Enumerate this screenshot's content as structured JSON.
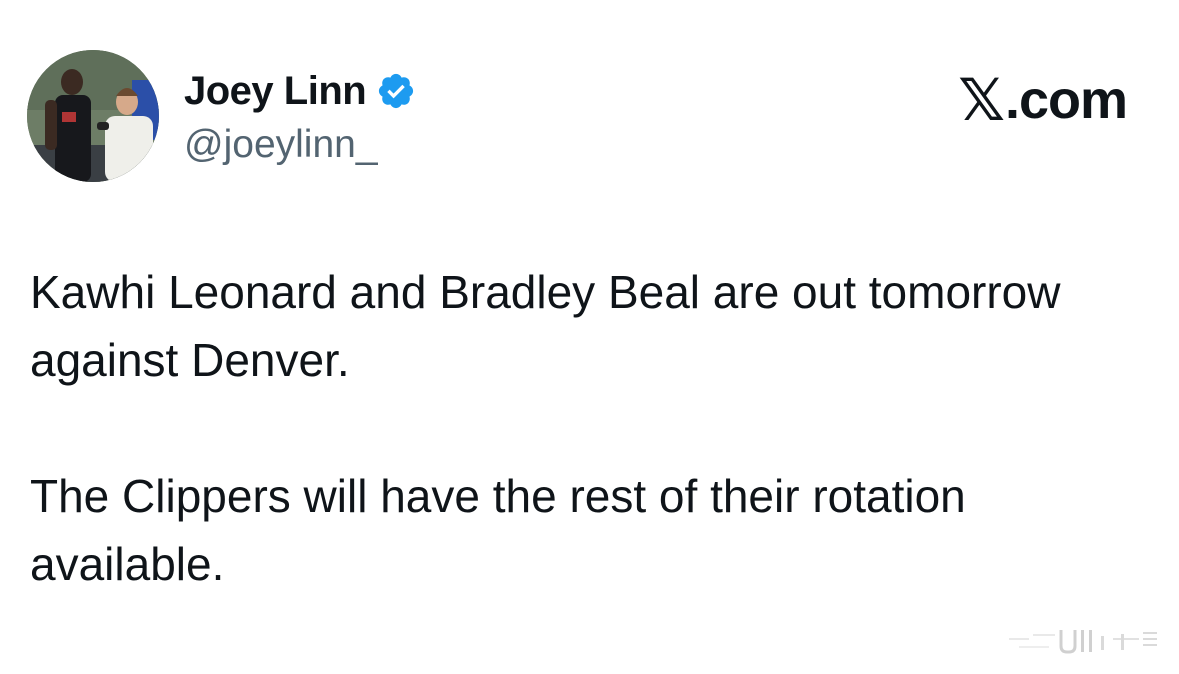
{
  "author": {
    "display_name": "Joey Linn",
    "handle": "@joeylinn_",
    "verified_icon": "verified-badge-icon",
    "avatar_icon": "profile-photo"
  },
  "brand": {
    "logo_glyph": "𝕏",
    "label": ".com"
  },
  "tweet": {
    "paragraphs": [
      "Kawhi Leonard and Bradley Beal are out tomorrow against Denver.",
      "The Clippers will have the rest of their rotation available."
    ]
  },
  "colors": {
    "verified_blue": "#1d9bf0",
    "text_primary": "#0f1419",
    "text_secondary": "#536471"
  }
}
